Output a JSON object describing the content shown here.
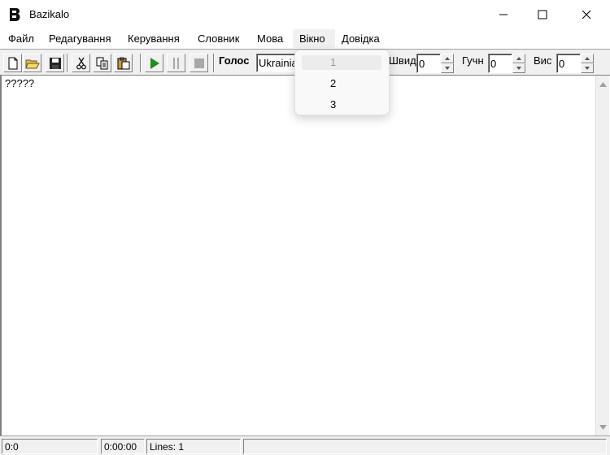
{
  "window": {
    "title": "Bazikalo",
    "icon": "bazikalo-app-icon"
  },
  "menu": {
    "items": [
      "Файл",
      "Редагування",
      "Керування",
      "Словник",
      "Мова",
      "Вікно",
      "Довідка"
    ],
    "active": "Вікно"
  },
  "dropdown": {
    "items": [
      {
        "label": "1",
        "enabled": false
      },
      {
        "label": "2",
        "enabled": true
      },
      {
        "label": "3",
        "enabled": true
      }
    ]
  },
  "toolbar": {
    "voice_label": "Голос",
    "voice_value": "Ukrainian",
    "speed_label": "Швид",
    "speed_value": "0",
    "volume_label": "Гучн",
    "volume_value": "0",
    "pitch_label": "Вис",
    "pitch_value": "0",
    "colors": {
      "play": "#1c8f1c",
      "disabled": "#a8a8a8"
    }
  },
  "editor": {
    "text": "?????"
  },
  "status": {
    "position": "0:0",
    "time": "0:00:00",
    "lines": "Lines: 1"
  }
}
